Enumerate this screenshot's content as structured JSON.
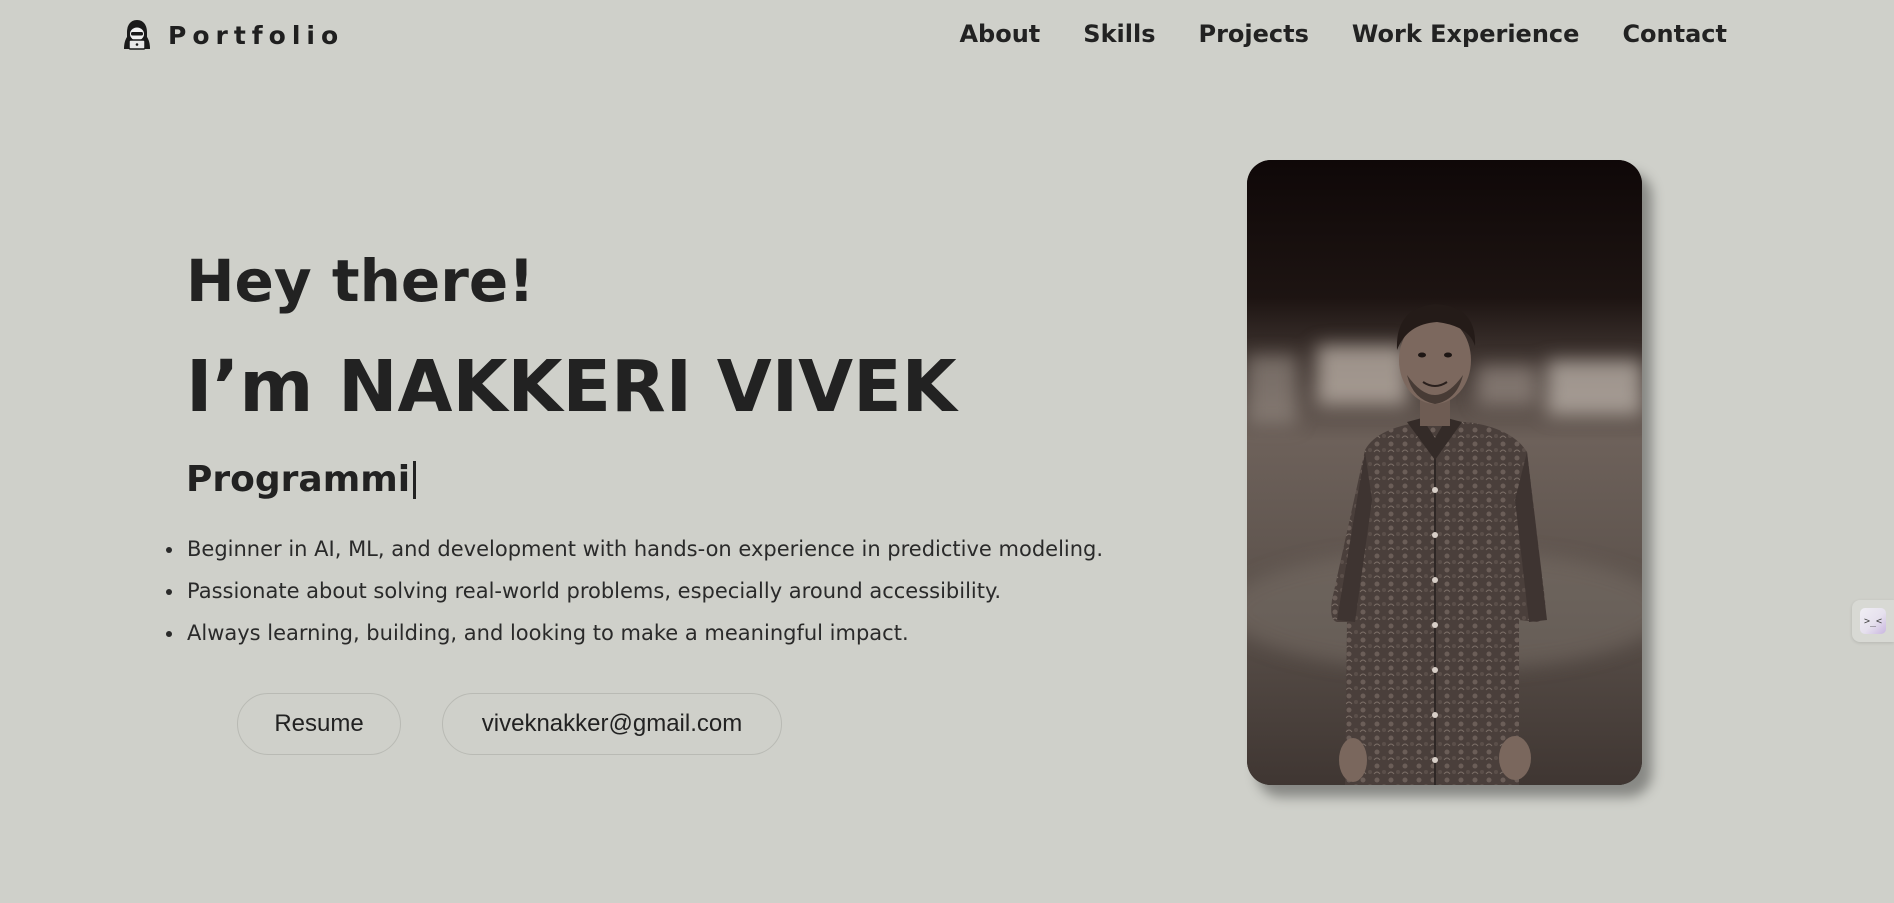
{
  "header": {
    "logo_text": "Portfolio",
    "nav": [
      "About",
      "Skills",
      "Projects",
      "Work Experience",
      "Contact"
    ]
  },
  "hero": {
    "greeting": "Hey there!",
    "name": "I’m NAKKERI VIVEK",
    "role_typed": "Programmi",
    "bullets": [
      "Beginner in AI, ML, and development with hands-on experience in predictive modeling.",
      "Passionate about solving real-world problems, especially around accessibility.",
      "Always learning, building, and looking to make a meaningful impact."
    ],
    "buttons": {
      "resume": "Resume",
      "email": "viveknakker@gmail.com"
    }
  },
  "side_widget": {
    "icon": "terminal-icon",
    "glyph": ">_<"
  },
  "colors": {
    "background": "#cfd0ca",
    "text": "#222222",
    "button_border": "#b9bab4"
  }
}
